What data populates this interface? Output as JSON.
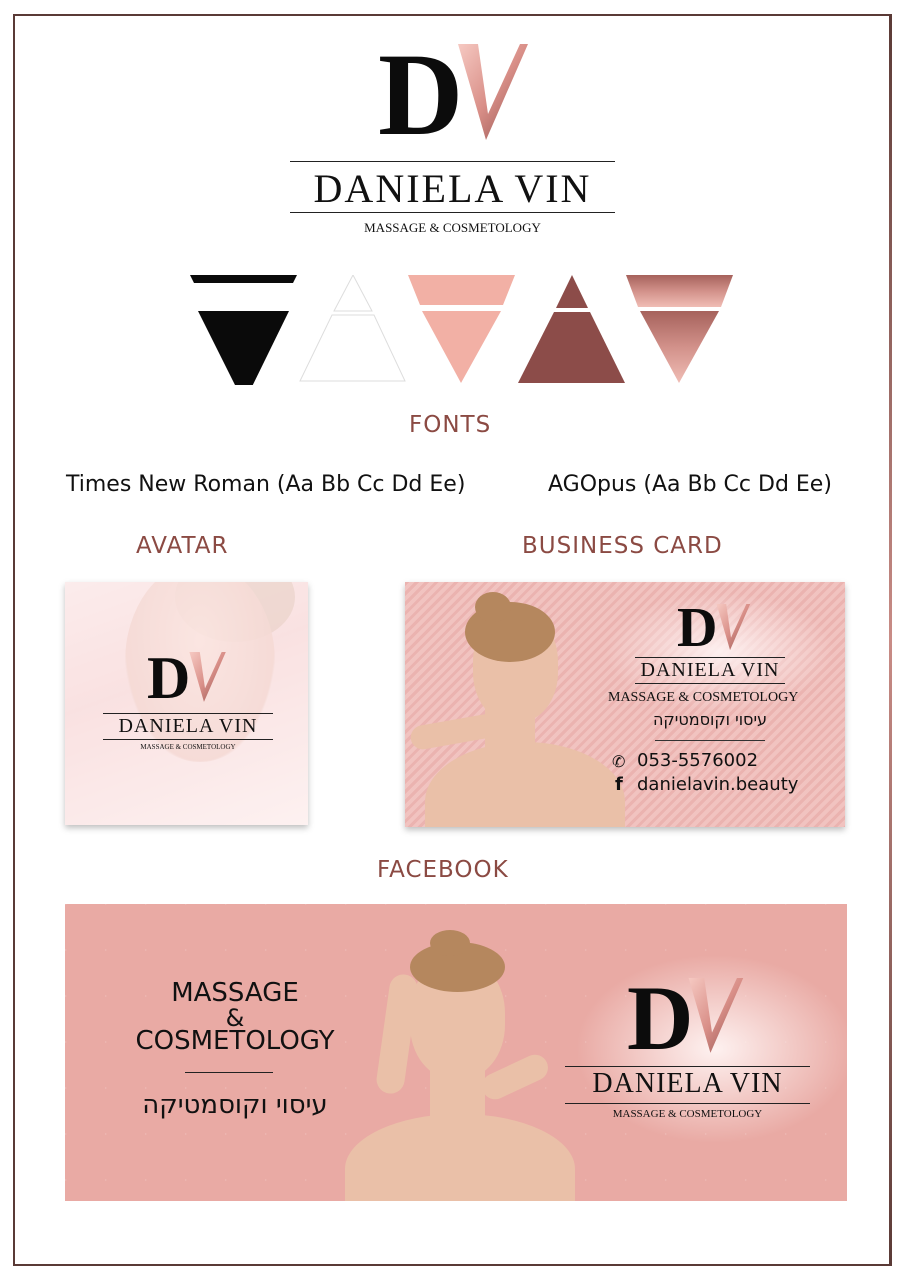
{
  "brand": {
    "monogram_d": "D",
    "monogram_v": "V",
    "name": "DANIELA VIN",
    "tagline": "MASSAGE & COSMETOLOGY"
  },
  "palette": {
    "colors": [
      "#0a0a0a",
      "#ffffff",
      "#f2b0a5",
      "#8c4c49",
      "#c47a73"
    ]
  },
  "sections": {
    "fonts": "FONTS",
    "avatar": "AVATAR",
    "business_card": "BUSINESS CARD",
    "facebook": "FACEBOOK"
  },
  "fonts": {
    "primary": "Times New Roman (Aa Bb Cc Dd Ee)",
    "secondary": "AGOpus (Aa Bb Cc Dd Ee)"
  },
  "business_card": {
    "hebrew": "עיסוי וקוסמטיקה",
    "phone": "053-5576002",
    "facebook": "danielavin.beauty",
    "phone_icon": "phone-icon",
    "facebook_icon": "facebook-icon"
  },
  "facebook_cover": {
    "line1": "MASSAGE",
    "line2": "&",
    "line3": "COSMETOLOGY",
    "hebrew": "עיסוי וקוסמטיקה"
  }
}
